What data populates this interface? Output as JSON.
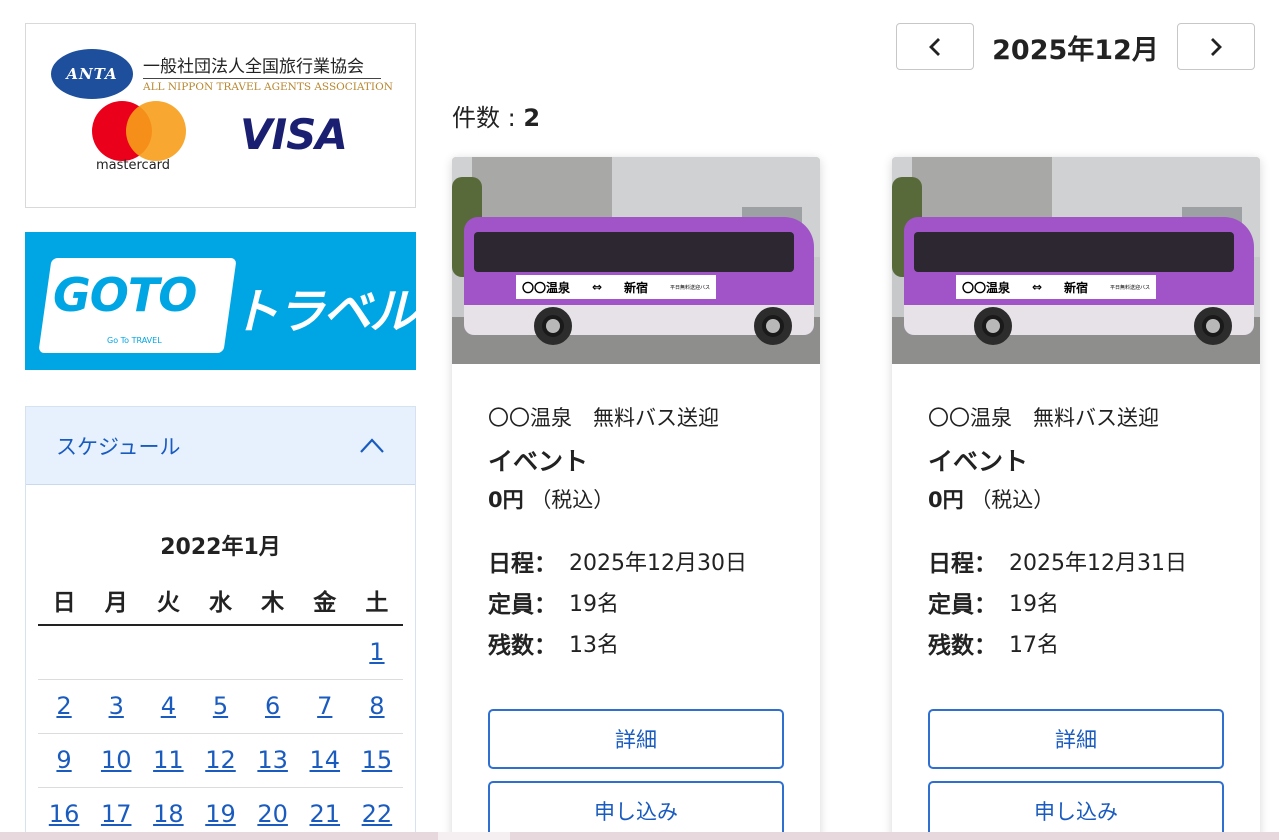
{
  "sidebar": {
    "anta": {
      "emblem": "ANTA",
      "name_jp": "一般社団法人全国旅行業協会",
      "name_en": "ALL NIPPON TRAVEL AGENTS ASSOCIATION"
    },
    "cards": {
      "mastercard": "mastercard",
      "visa": "VISA"
    },
    "goto": {
      "main": "GOTO",
      "kana": "トラベル",
      "small": "Go To TRAVEL"
    },
    "schedule": {
      "title": "スケジュール",
      "month": "2022年1月",
      "weekdays": [
        "日",
        "月",
        "火",
        "水",
        "木",
        "金",
        "土"
      ],
      "weeks": [
        [
          "",
          "",
          "",
          "",
          "",
          "",
          "1"
        ],
        [
          "2",
          "3",
          "4",
          "5",
          "6",
          "7",
          "8"
        ],
        [
          "9",
          "10",
          "11",
          "12",
          "13",
          "14",
          "15"
        ],
        [
          "16",
          "17",
          "18",
          "19",
          "20",
          "21",
          "22"
        ]
      ]
    }
  },
  "main": {
    "month": "2025年12月",
    "count_label": "件数 : ",
    "count": "2",
    "cards": [
      {
        "bus_sign_left": "〇〇温泉",
        "bus_sign_arrow": "⇔",
        "bus_sign_right": "新宿",
        "bus_sign_small": "平日無料送迎バス",
        "category": "〇〇温泉　無料バス送迎",
        "name": "イベント",
        "price": "0円",
        "tax": "（税込）",
        "date_label": "日程：",
        "date": "2025年12月30日",
        "capacity_label": "定員：",
        "capacity": "19名",
        "remaining_label": "残数：",
        "remaining": "13名",
        "detail_button": "詳細",
        "apply_button": "申し込み"
      },
      {
        "bus_sign_left": "〇〇温泉",
        "bus_sign_arrow": "⇔",
        "bus_sign_right": "新宿",
        "bus_sign_small": "平日無料送迎バス",
        "category": "〇〇温泉　無料バス送迎",
        "name": "イベント",
        "price": "0円",
        "tax": "（税込）",
        "date_label": "日程：",
        "date": "2025年12月31日",
        "capacity_label": "定員：",
        "capacity": "19名",
        "remaining_label": "残数：",
        "remaining": "17名",
        "detail_button": "詳細",
        "apply_button": "申し込み"
      }
    ]
  },
  "colors": {
    "accent_blue": "#1a5bbf",
    "goto_blue": "#00a6e4",
    "schedule_header_bg": "#e6f1fd",
    "bus_purple": "#a054c8"
  },
  "icons": {
    "prev": "chevron-left-icon",
    "next": "chevron-right-icon",
    "collapse": "chevron-up-icon"
  }
}
